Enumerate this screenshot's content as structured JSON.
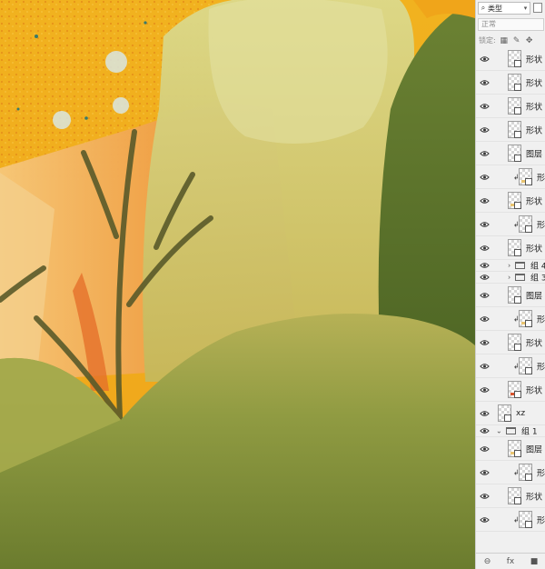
{
  "canvas": {
    "artwork_icon": "illustration-painting"
  },
  "layers_panel": {
    "filter": {
      "icon": "search-icon",
      "label": "类型"
    },
    "blend_mode": "正常",
    "lock_label": "锁定:",
    "layers": [
      {
        "type": "layer",
        "name": "形状",
        "clipped": false,
        "thumb_color": ""
      },
      {
        "type": "layer",
        "name": "形状",
        "clipped": false,
        "thumb_color": ""
      },
      {
        "type": "layer",
        "name": "形状",
        "clipped": false,
        "thumb_color": ""
      },
      {
        "type": "layer",
        "name": "形状",
        "clipped": false,
        "thumb_color": ""
      },
      {
        "type": "layer",
        "name": "图层",
        "clipped": false,
        "thumb_color": ""
      },
      {
        "type": "layer",
        "name": "形",
        "clipped": true,
        "thumb_color": "#e9c470"
      },
      {
        "type": "layer",
        "name": "形状",
        "clipped": false,
        "thumb_color": "#e9c470"
      },
      {
        "type": "layer",
        "name": "形",
        "clipped": true,
        "thumb_color": ""
      },
      {
        "type": "layer",
        "name": "形状",
        "clipped": false,
        "thumb_color": ""
      },
      {
        "type": "group",
        "name": "组 4",
        "expanded": false
      },
      {
        "type": "group",
        "name": "组 3",
        "expanded": false
      },
      {
        "type": "layer",
        "name": "图层",
        "clipped": false,
        "thumb_color": ""
      },
      {
        "type": "layer",
        "name": "形",
        "clipped": true,
        "thumb_color": "#e9c470"
      },
      {
        "type": "layer",
        "name": "形状",
        "clipped": false,
        "thumb_color": ""
      },
      {
        "type": "layer",
        "name": "形",
        "clipped": true,
        "thumb_color": ""
      },
      {
        "type": "layer",
        "name": "形状",
        "clipped": false,
        "thumb_color": "#d9552e"
      },
      {
        "type": "layer",
        "name": "xz",
        "clipped": false,
        "thumb_color": ""
      },
      {
        "type": "group",
        "name": "组 1",
        "expanded": true
      },
      {
        "type": "layer",
        "name": "图层",
        "clipped": false,
        "thumb_color": "#e9c470"
      },
      {
        "type": "layer",
        "name": "形",
        "clipped": true,
        "thumb_color": ""
      },
      {
        "type": "layer",
        "name": "形状",
        "clipped": false,
        "thumb_color": ""
      },
      {
        "type": "layer",
        "name": "形",
        "clipped": true,
        "thumb_color": ""
      }
    ],
    "bottom_icons": [
      "link-icon",
      "fx-icon",
      "mask-icon"
    ],
    "fx_label": "fx"
  }
}
